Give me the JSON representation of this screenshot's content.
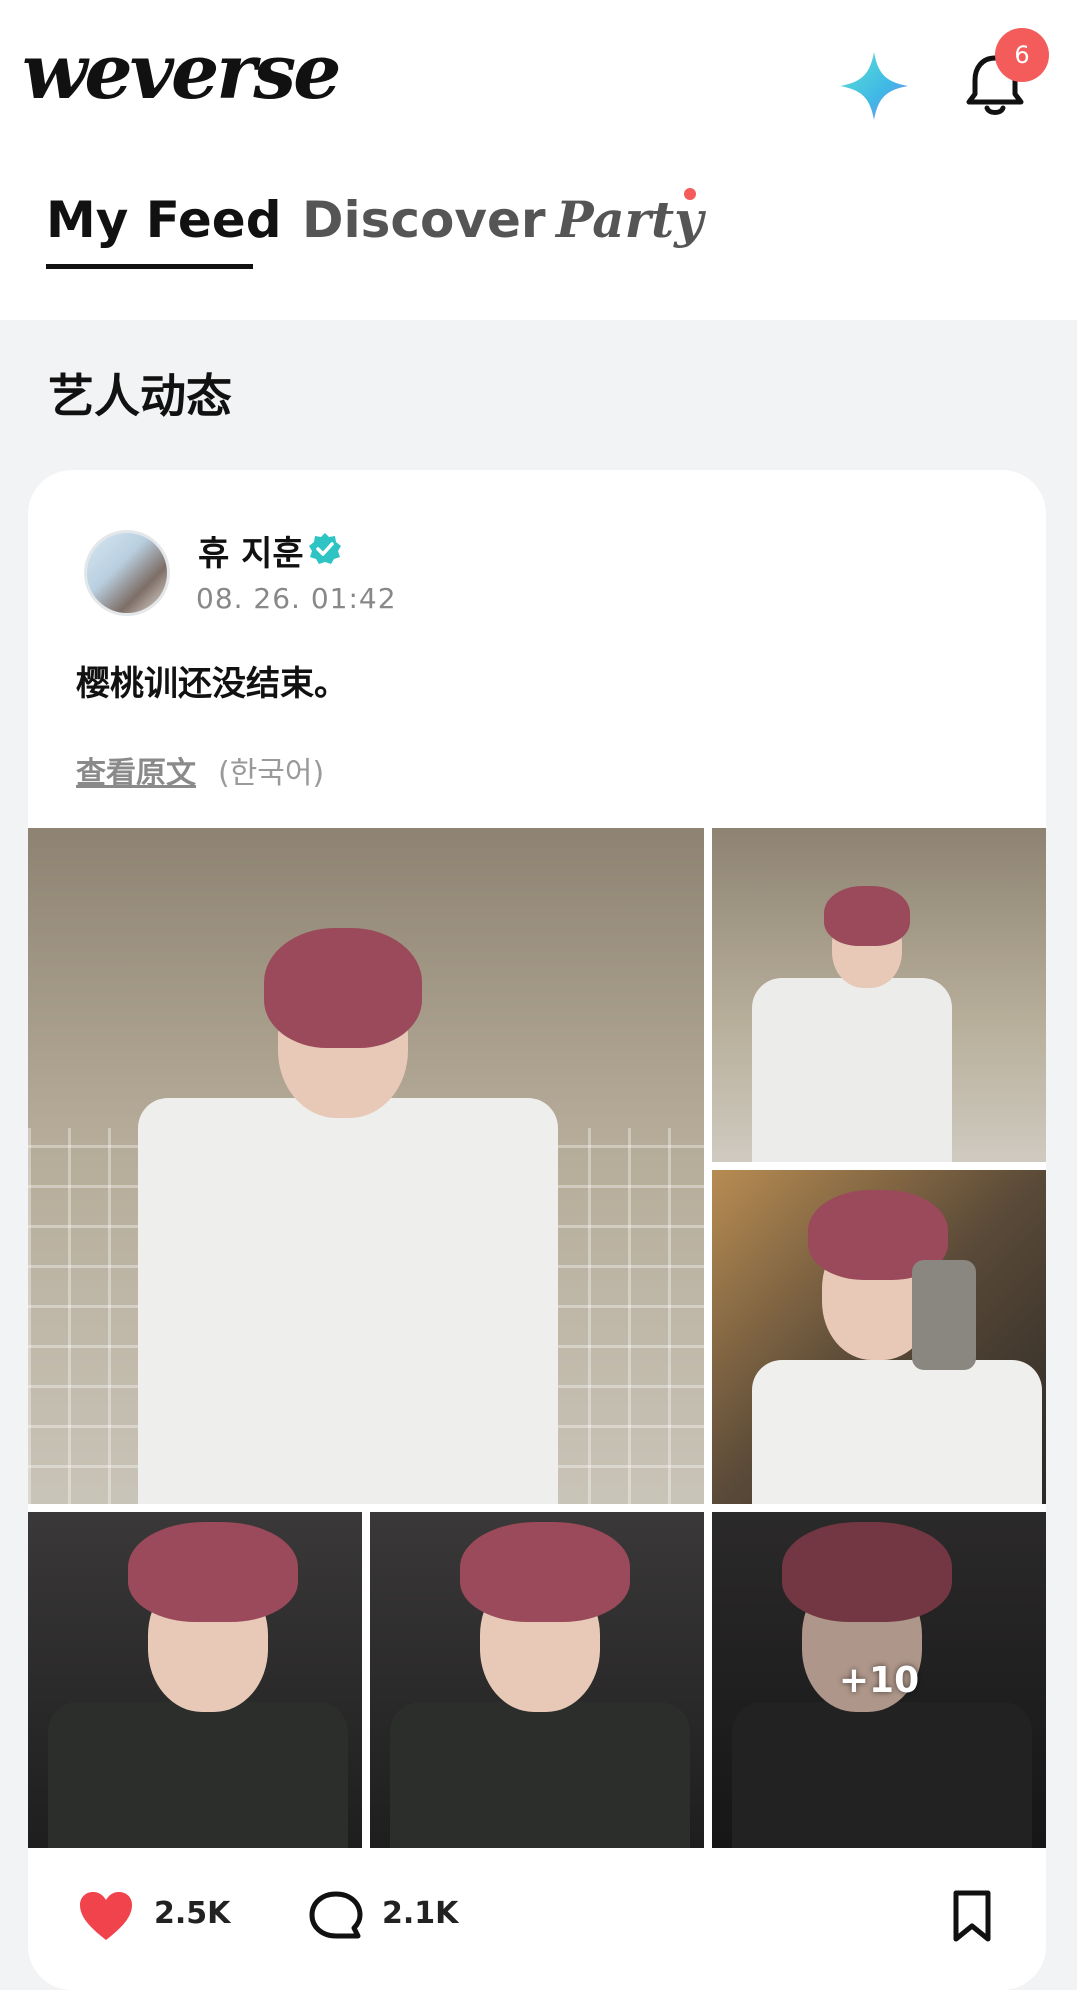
{
  "header": {
    "logo": "weverse",
    "notification_count": "6"
  },
  "tabs": [
    {
      "label": "My Feed",
      "active": true
    },
    {
      "label": "Discover",
      "active": false
    },
    {
      "label": "Party",
      "active": false
    }
  ],
  "section_title": "艺人动态",
  "post": {
    "author": "휴 지훈",
    "timestamp": "08. 26. 01:42",
    "text": "樱桃训还没结束。",
    "view_original": "查看原文",
    "original_language": "(한국어)",
    "more_photos": "+10",
    "likes": "2.5K",
    "comments": "2.1K"
  },
  "colors": {
    "accent_red": "#f45b5b",
    "verified_teal": "#2ec4c4",
    "like_red": "#f0434b"
  }
}
